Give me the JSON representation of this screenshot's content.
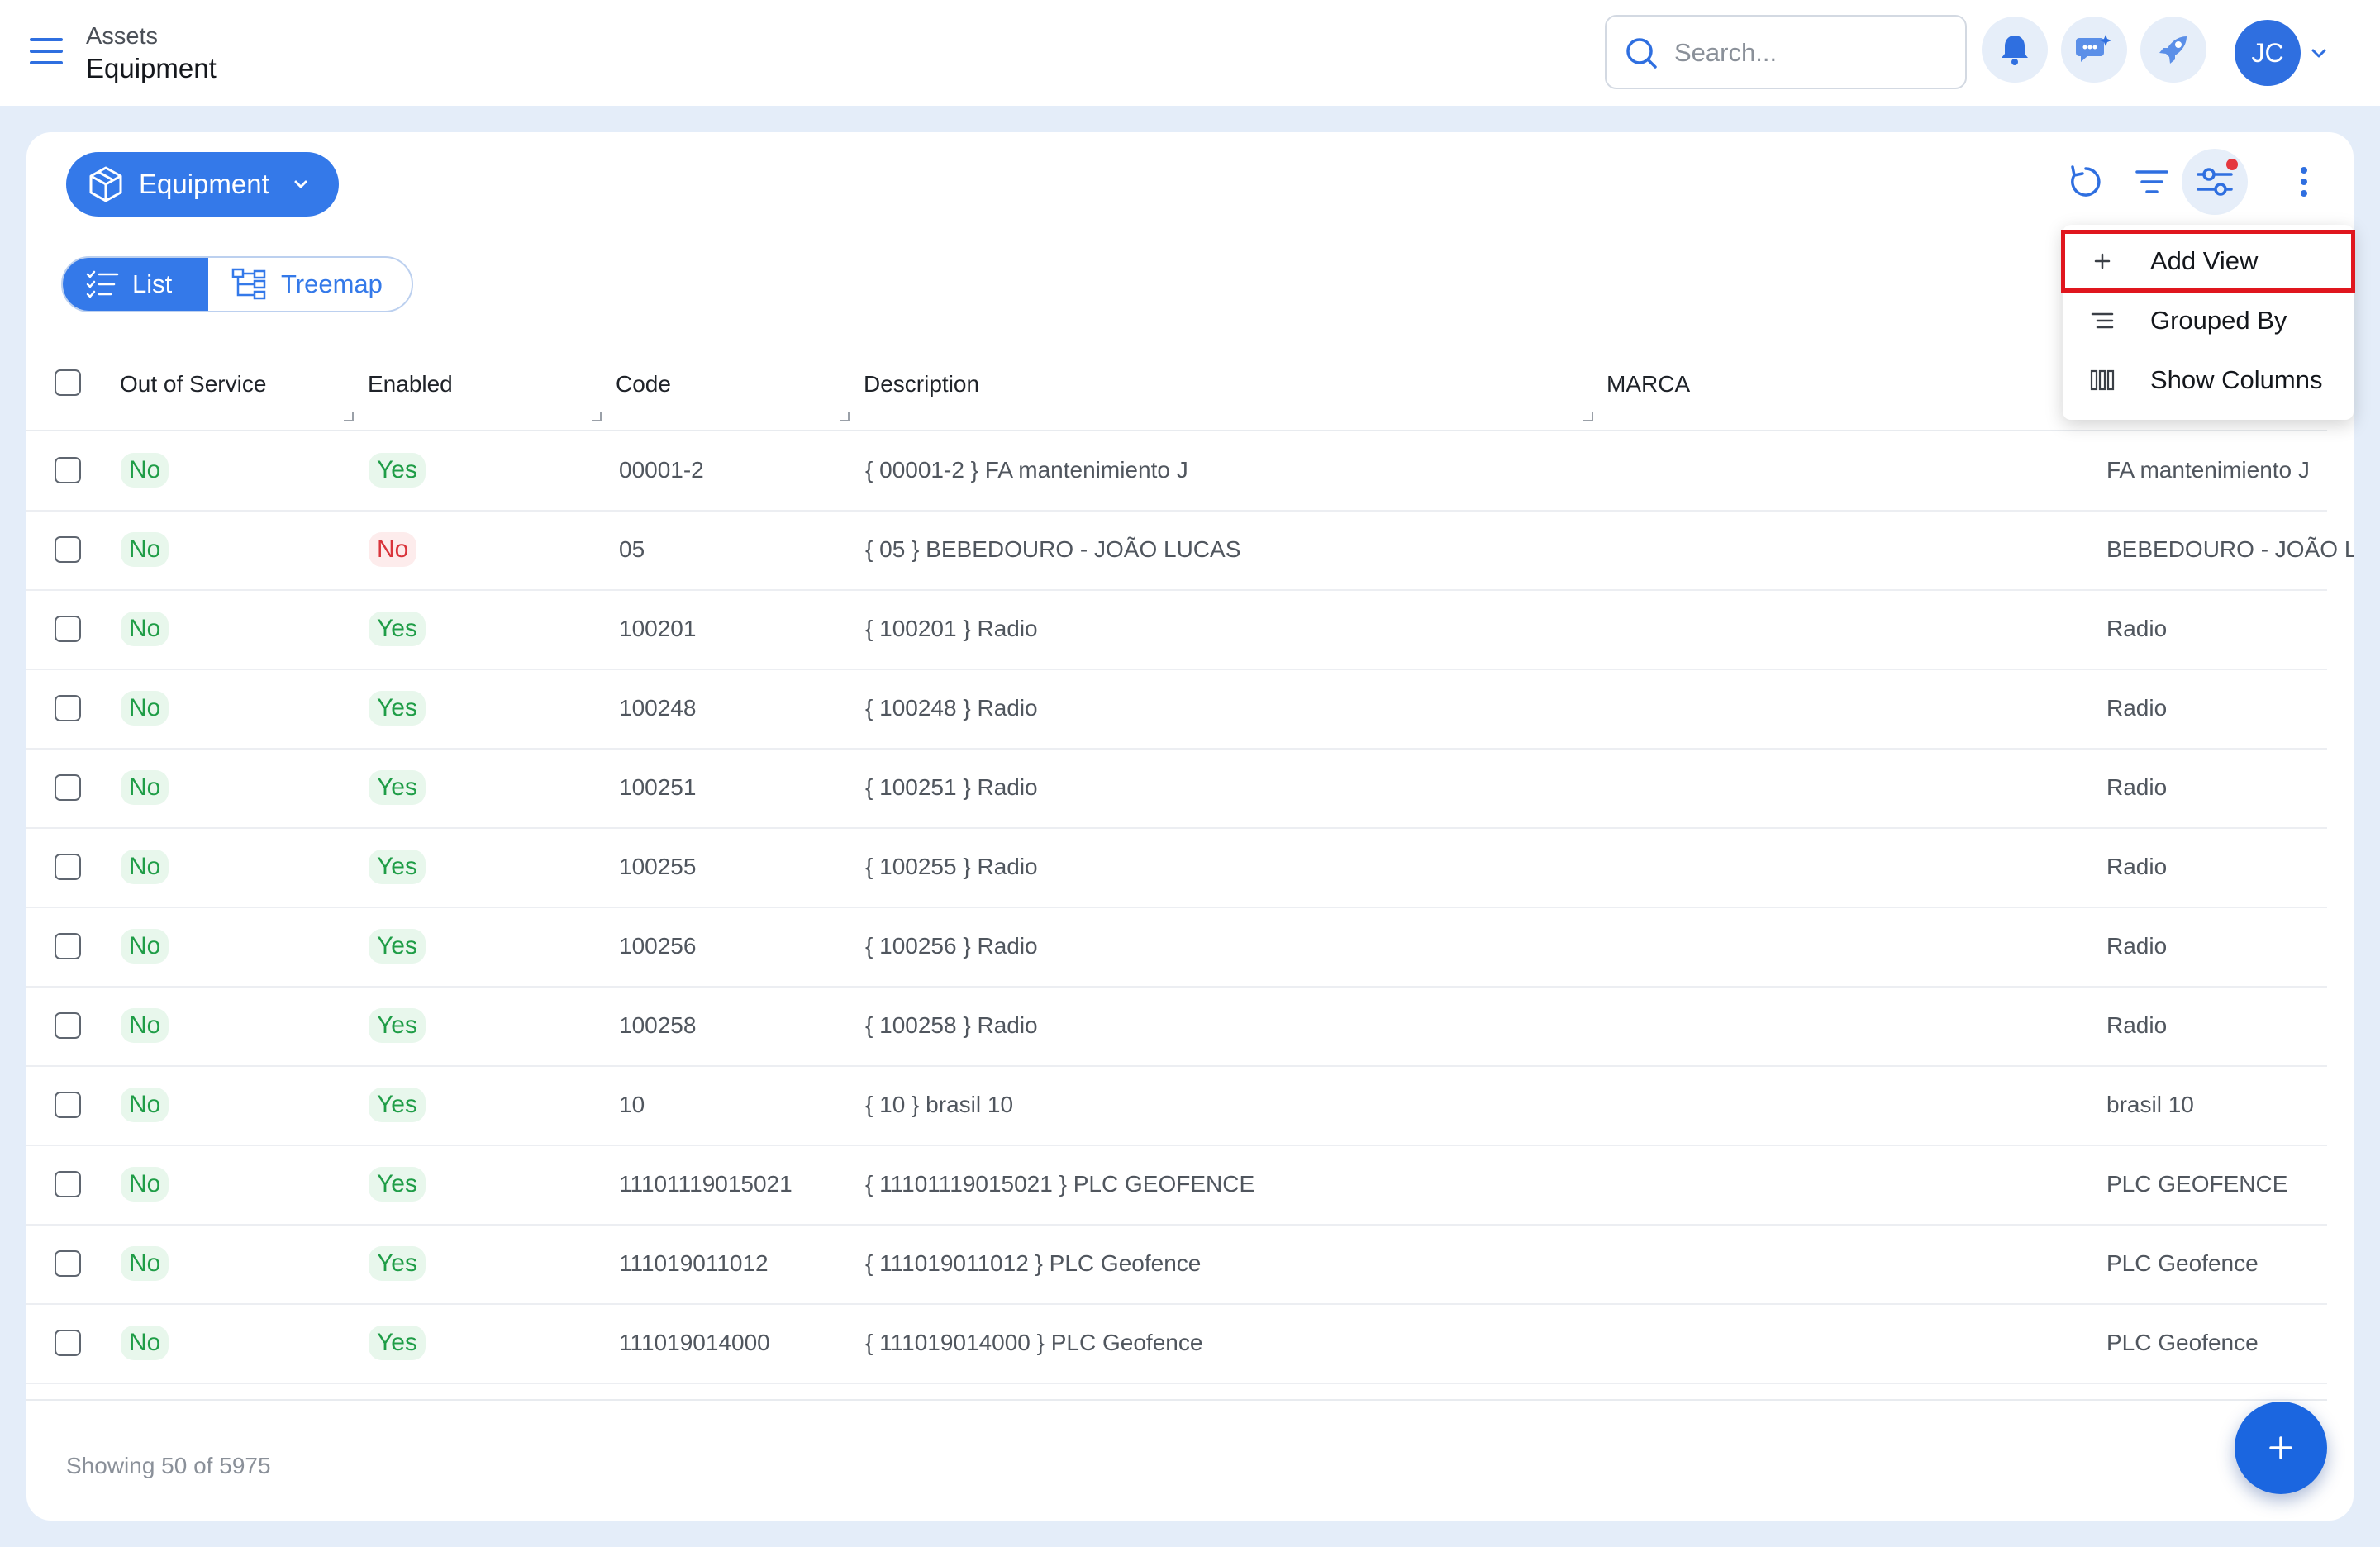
{
  "header": {
    "breadcrumb_parent": "Assets",
    "page_title": "Equipment",
    "search_placeholder": "Search...",
    "avatar_initials": "JC"
  },
  "toolbar": {
    "entity_label": "Equipment",
    "view_list": "List",
    "view_treemap": "Treemap"
  },
  "menu": {
    "add_view": "Add View",
    "grouped_by": "Grouped By",
    "show_columns": "Show Columns"
  },
  "columns": {
    "out_of_service": "Out of Service",
    "enabled": "Enabled",
    "code": "Code",
    "description": "Description",
    "marca": "MARCA"
  },
  "rows": [
    {
      "out_of_service": "No",
      "enabled": "Yes",
      "code": "00001-2",
      "description": "{ 00001-2 } FA mantenimiento J",
      "name": "FA mantenimiento J"
    },
    {
      "out_of_service": "No",
      "enabled": "No",
      "code": "05",
      "description": "{ 05 } BEBEDOURO - JOÃO LUCAS",
      "name": "BEBEDOURO - JOÃO LUCAS"
    },
    {
      "out_of_service": "No",
      "enabled": "Yes",
      "code": "100201",
      "description": "{ 100201 } Radio",
      "name": "Radio"
    },
    {
      "out_of_service": "No",
      "enabled": "Yes",
      "code": "100248",
      "description": "{ 100248 } Radio",
      "name": "Radio"
    },
    {
      "out_of_service": "No",
      "enabled": "Yes",
      "code": "100251",
      "description": "{ 100251 } Radio",
      "name": "Radio"
    },
    {
      "out_of_service": "No",
      "enabled": "Yes",
      "code": "100255",
      "description": "{ 100255 } Radio",
      "name": "Radio"
    },
    {
      "out_of_service": "No",
      "enabled": "Yes",
      "code": "100256",
      "description": "{ 100256 } Radio",
      "name": "Radio"
    },
    {
      "out_of_service": "No",
      "enabled": "Yes",
      "code": "100258",
      "description": "{ 100258 } Radio",
      "name": "Radio"
    },
    {
      "out_of_service": "No",
      "enabled": "Yes",
      "code": "10",
      "description": "{ 10 } brasil 10",
      "name": "brasil 10"
    },
    {
      "out_of_service": "No",
      "enabled": "Yes",
      "code": "11101119015021",
      "description": "{ 11101119015021 } PLC GEOFENCE",
      "name": "PLC GEOFENCE"
    },
    {
      "out_of_service": "No",
      "enabled": "Yes",
      "code": "111019011012",
      "description": "{ 111019011012 } PLC Geofence",
      "name": "PLC Geofence"
    },
    {
      "out_of_service": "No",
      "enabled": "Yes",
      "code": "111019014000",
      "description": "{ 111019014000 } PLC Geofence",
      "name": "PLC Geofence"
    }
  ],
  "footer": {
    "showing_text": "Showing 50 of 5975"
  },
  "colors": {
    "accent": "#3479e9",
    "status_green": "#1f9d47",
    "status_red": "#d9343b",
    "highlight_outline": "#e0161e"
  }
}
